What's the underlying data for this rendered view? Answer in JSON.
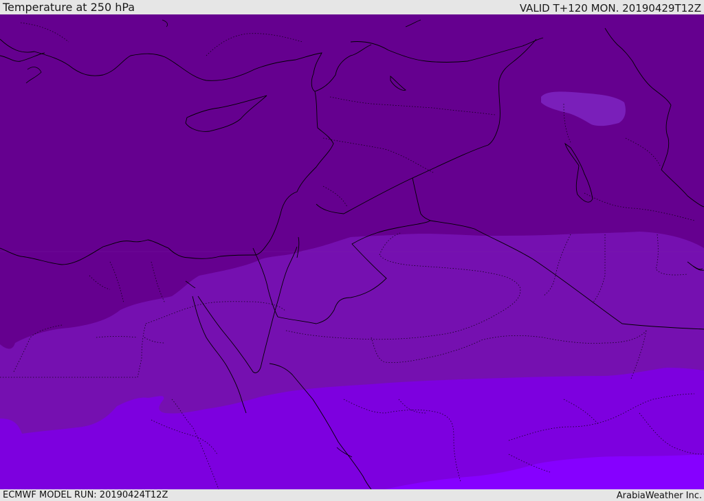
{
  "header": {
    "title": "Temperature at 250 hPa",
    "valid": "VALID T+120 MON. 20190429T12Z"
  },
  "footer": {
    "model_run": "ECMWF MODEL RUN: 20190424T12Z",
    "brand": "ArabiaWeather Inc."
  },
  "map": {
    "colors": {
      "band_1": "#65008f",
      "band_2": "#7510b0",
      "band_3": "#7d00df",
      "band_4": "#8600ff",
      "patch": "#7a1fba",
      "border": "#000000"
    }
  }
}
